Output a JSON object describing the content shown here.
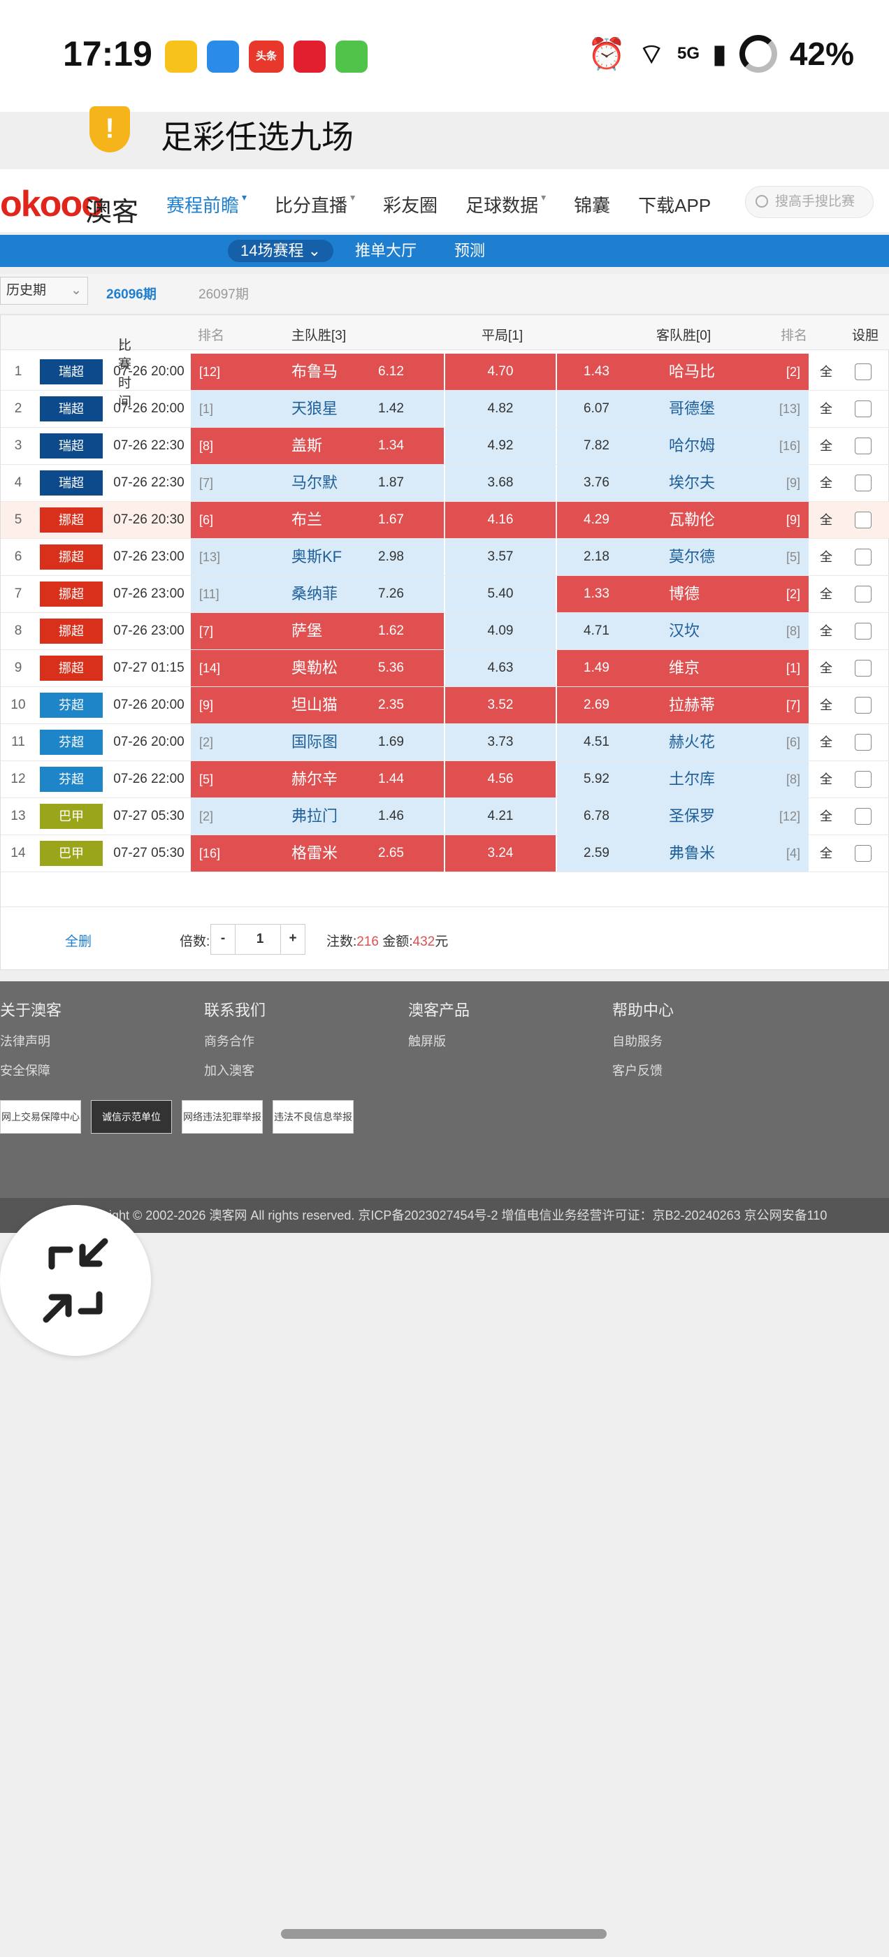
{
  "status": {
    "time": "17:19",
    "network": "5G",
    "battery": "42%",
    "app_icon_label": "头条"
  },
  "ticker": {
    "title": "足彩任选九场",
    "icon": "alert-shield-icon"
  },
  "brand": {
    "logo_latin": "okooo",
    "logo_cn": "澳客"
  },
  "nav": {
    "items": [
      "赛程前瞻",
      "比分直播",
      "彩友圈",
      "足球数据",
      "锦囊",
      "下载APP"
    ],
    "active": "赛程前瞻",
    "search_placeholder": "搜高手搜比赛"
  },
  "subnav": {
    "items": [
      "14场赛程",
      "推单大厅",
      "预测"
    ]
  },
  "filter": {
    "history": "历史期",
    "current": "26096期",
    "next": "26097期"
  },
  "table": {
    "headers": {
      "time": "比赛时间",
      "rank_home": "排名",
      "home": "主队胜[3]",
      "draw": "平局[1]",
      "away": "客队胜[0]",
      "rank_away": "排名",
      "setgall": "设胆"
    },
    "all_label": "全",
    "rows": [
      {
        "no": "1",
        "league": "瑞超",
        "lcolor": "#0d4a8c",
        "time": "07-26 20:00",
        "hr": "[12]",
        "home": "布鲁马",
        "ho": "6.12",
        "d": "4.70",
        "ao": "1.43",
        "away": "哈马比",
        "ar": "[2]",
        "hs": "red",
        "ds": "red",
        "as": "red"
      },
      {
        "no": "2",
        "league": "瑞超",
        "lcolor": "#0d4a8c",
        "time": "07-26 20:00",
        "hr": "[1]",
        "home": "天狼星",
        "ho": "1.42",
        "d": "4.82",
        "ao": "6.07",
        "away": "哥德堡",
        "ar": "[13]",
        "hs": "blue",
        "ds": "blue",
        "as": "blue"
      },
      {
        "no": "3",
        "league": "瑞超",
        "lcolor": "#0d4a8c",
        "time": "07-26 22:30",
        "hr": "[8]",
        "home": "盖斯",
        "ho": "1.34",
        "d": "4.92",
        "ao": "7.82",
        "away": "哈尔姆",
        "ar": "[16]",
        "hs": "red",
        "ds": "blue",
        "as": "blue"
      },
      {
        "no": "4",
        "league": "瑞超",
        "lcolor": "#0d4a8c",
        "time": "07-26 22:30",
        "hr": "[7]",
        "home": "马尔默",
        "ho": "1.87",
        "d": "3.68",
        "ao": "3.76",
        "away": "埃尔夫",
        "ar": "[9]",
        "hs": "blue",
        "ds": "blue",
        "as": "blue"
      },
      {
        "no": "5",
        "league": "挪超",
        "lcolor": "#d9301c",
        "time": "07-26 20:30",
        "hr": "[6]",
        "home": "布兰",
        "ho": "1.67",
        "d": "4.16",
        "ao": "4.29",
        "away": "瓦勒伦",
        "ar": "[9]",
        "hs": "red",
        "ds": "red",
        "as": "red"
      },
      {
        "no": "6",
        "league": "挪超",
        "lcolor": "#d9301c",
        "time": "07-26 23:00",
        "hr": "[13]",
        "home": "奥斯KF",
        "ho": "2.98",
        "d": "3.57",
        "ao": "2.18",
        "away": "莫尔德",
        "ar": "[5]",
        "hs": "blue",
        "ds": "blue",
        "as": "blue"
      },
      {
        "no": "7",
        "league": "挪超",
        "lcolor": "#d9301c",
        "time": "07-26 23:00",
        "hr": "[11]",
        "home": "桑纳菲",
        "ho": "7.26",
        "d": "5.40",
        "ao": "1.33",
        "away": "博德",
        "ar": "[2]",
        "hs": "blue",
        "ds": "blue",
        "as": "red"
      },
      {
        "no": "8",
        "league": "挪超",
        "lcolor": "#d9301c",
        "time": "07-26 23:00",
        "hr": "[7]",
        "home": "萨堡",
        "ho": "1.62",
        "d": "4.09",
        "ao": "4.71",
        "away": "汉坎",
        "ar": "[8]",
        "hs": "red",
        "ds": "blue",
        "as": "blue"
      },
      {
        "no": "9",
        "league": "挪超",
        "lcolor": "#d9301c",
        "time": "07-27 01:15",
        "hr": "[14]",
        "home": "奥勒松",
        "ho": "5.36",
        "d": "4.63",
        "ao": "1.49",
        "away": "维京",
        "ar": "[1]",
        "hs": "red",
        "ds": "blue",
        "as": "red"
      },
      {
        "no": "10",
        "league": "芬超",
        "lcolor": "#1e86c8",
        "time": "07-26 20:00",
        "hr": "[9]",
        "home": "坦山猫",
        "ho": "2.35",
        "d": "3.52",
        "ao": "2.69",
        "away": "拉赫蒂",
        "ar": "[7]",
        "hs": "red",
        "ds": "red",
        "as": "red"
      },
      {
        "no": "11",
        "league": "芬超",
        "lcolor": "#1e86c8",
        "time": "07-26 20:00",
        "hr": "[2]",
        "home": "国际图",
        "ho": "1.69",
        "d": "3.73",
        "ao": "4.51",
        "away": "赫火花",
        "ar": "[6]",
        "hs": "blue",
        "ds": "blue",
        "as": "blue"
      },
      {
        "no": "12",
        "league": "芬超",
        "lcolor": "#1e86c8",
        "time": "07-26 22:00",
        "hr": "[5]",
        "home": "赫尔辛",
        "ho": "1.44",
        "d": "4.56",
        "ao": "5.92",
        "away": "土尔库",
        "ar": "[8]",
        "hs": "red",
        "ds": "red",
        "as": "blue"
      },
      {
        "no": "13",
        "league": "巴甲",
        "lcolor": "#9aa51a",
        "time": "07-27 05:30",
        "hr": "[2]",
        "home": "弗拉门",
        "ho": "1.46",
        "d": "4.21",
        "ao": "6.78",
        "away": "圣保罗",
        "ar": "[12]",
        "hs": "blue",
        "ds": "blue",
        "as": "blue"
      },
      {
        "no": "14",
        "league": "巴甲",
        "lcolor": "#9aa51a",
        "time": "07-27 05:30",
        "hr": "[16]",
        "home": "格雷米",
        "ho": "2.65",
        "d": "3.24",
        "ao": "2.59",
        "away": "弗鲁米",
        "ar": "[4]",
        "hs": "red",
        "ds": "red",
        "as": "blue"
      }
    ],
    "footer": {
      "clear": "全删",
      "multiplier_label": "倍数:",
      "minus": "-",
      "multiplier": "1",
      "plus": "+",
      "bets_label": "注数:",
      "bets": "216",
      "amount_label": "金额:",
      "amount": "432",
      "unit": "元"
    }
  },
  "site_footer": {
    "cols": [
      {
        "title": "关于澳客",
        "items": [
          "法律声明",
          "安全保障"
        ]
      },
      {
        "title": "联系我们",
        "items": [
          "商务合作",
          "加入澳客"
        ]
      },
      {
        "title": "澳客产品",
        "items": [
          "触屏版"
        ]
      },
      {
        "title": "帮助中心",
        "items": [
          "自助服务",
          "客户反馈"
        ]
      }
    ],
    "badges": [
      "网上交易保障中心",
      "诚信示范单位",
      "网络违法犯罪举报",
      "违法不良信息举报"
    ],
    "copyright": "right © 2002-2026 澳客网  All rights reserved.   京ICP备2023027454号-2  增值电信业务经营许可证：京B2-20240263  京公网安备110"
  },
  "float_button": {
    "icon": "collapse-arrows-icon"
  }
}
